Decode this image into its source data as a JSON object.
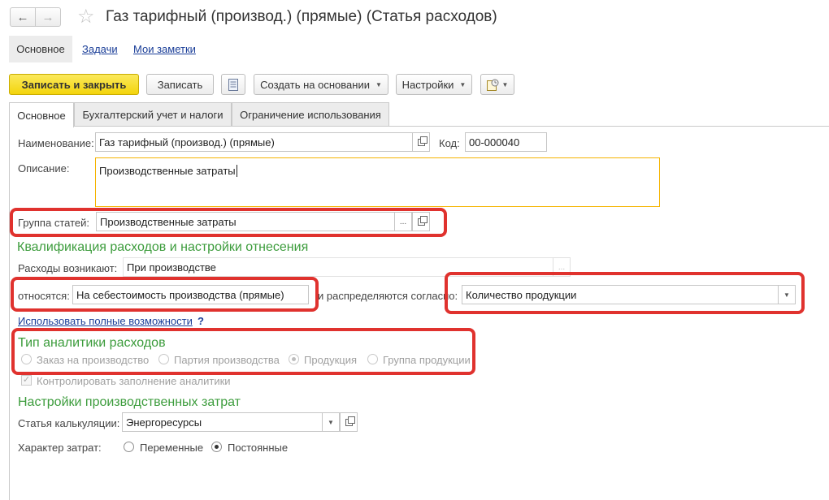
{
  "window": {
    "title": "Газ тарифный (производ.) (прямые) (Статья расходов)"
  },
  "nav": {
    "back": "←",
    "forward": "→",
    "favorite": "☆"
  },
  "section_tabs": [
    {
      "label": "Основное"
    },
    {
      "label": "Задачи"
    },
    {
      "label": "Мои заметки"
    }
  ],
  "toolbar": {
    "save_close": "Записать и закрыть",
    "save": "Записать",
    "create_based": "Создать на основании",
    "settings": "Настройки"
  },
  "form_tabs": [
    {
      "label": "Основное"
    },
    {
      "label": "Бухгалтерский учет и налоги"
    },
    {
      "label": "Ограничение использования"
    }
  ],
  "fields": {
    "name_label": "Наименование:",
    "name_value": "Газ тарифный (производ.) (прямые)",
    "code_label": "Код:",
    "code_value": "00-000040",
    "description_label": "Описание:",
    "description_value": "Производственные затраты",
    "group_label": "Группа статей:",
    "group_value": "Производственные затраты",
    "group_select": "..."
  },
  "qualification": {
    "heading": "Квалификация расходов и настройки отнесения",
    "arise_label": "Расходы возникают:",
    "arise_value": "При производстве",
    "arise_select": "...",
    "relate_label": "относятся:",
    "relate_value": "На себестоимость производства (прямые)",
    "distribute_label": "и распределяются согласно:",
    "distribute_value": "Количество продукции",
    "full_link": "Использовать полные возможности",
    "help": "?"
  },
  "analytics": {
    "heading": "Тип аналитики расходов",
    "options": [
      {
        "label": "Заказ на производство",
        "selected": false
      },
      {
        "label": "Партия производства",
        "selected": false
      },
      {
        "label": "Продукция",
        "selected": true
      },
      {
        "label": "Группа продукции",
        "selected": false
      }
    ],
    "control_label": "Контролировать заполнение аналитики",
    "control_check": "✓"
  },
  "production": {
    "heading": "Настройки производственных затрат",
    "calc_label": "Статья калькуляции:",
    "calc_value": "Энергоресурсы",
    "nature_label": "Характер затрат:",
    "nature_options": [
      {
        "label": "Переменные",
        "selected": false
      },
      {
        "label": "Постоянные",
        "selected": true
      }
    ]
  },
  "colors": {
    "accent_yellow": "#f3d40c",
    "heading_green": "#3c9c3c",
    "highlight_red": "#e0322e",
    "link_blue": "#1a3e98"
  }
}
